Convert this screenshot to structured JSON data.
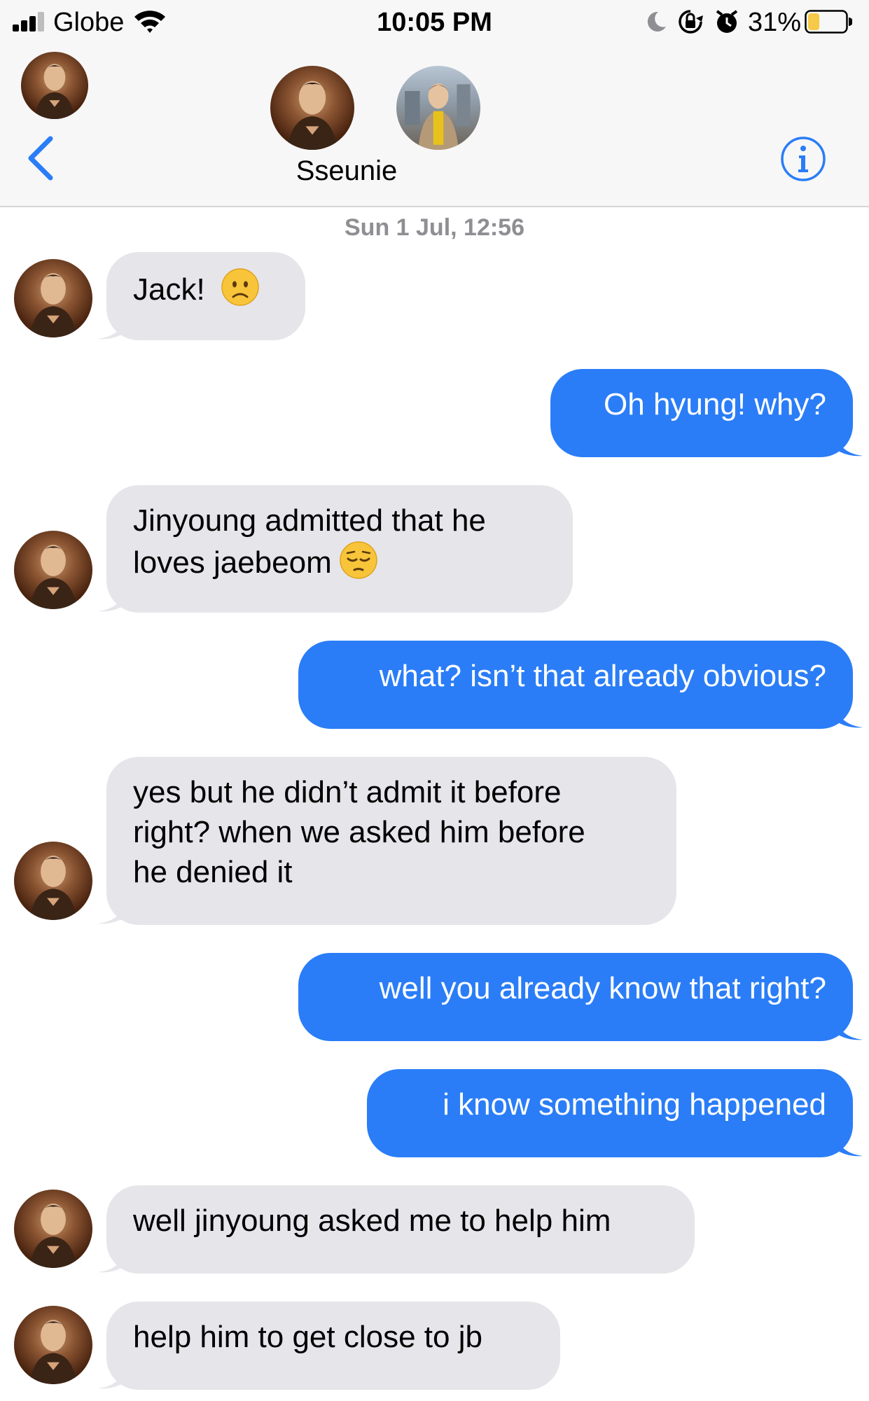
{
  "status_bar": {
    "carrier": "Globe",
    "time": "10:05 PM",
    "battery": "31%",
    "battery_level": 0.31
  },
  "header": {
    "contact_name": "Sseunie",
    "back_icon": "chevron-left-icon",
    "info_icon": "info-icon"
  },
  "conversation": {
    "timestamp": "Sun 1 Jul, 12:56",
    "messages": [
      {
        "from": "them",
        "text": "Jack!",
        "emoji": "slightly-frowning-face"
      },
      {
        "from": "me",
        "text": "Oh hyung! why?"
      },
      {
        "from": "them",
        "line1": "Jinyoung admitted that he",
        "line2": "loves jaebeom",
        "emoji": "pensive-face"
      },
      {
        "from": "me",
        "text": "what? isn’t that already obvious?"
      },
      {
        "from": "them",
        "line1": "yes but he didn’t admit it before",
        "line2": "right? when we asked him before",
        "line3": "he denied it"
      },
      {
        "from": "me",
        "text": "well you already know that right?"
      },
      {
        "from": "me",
        "text": "i know something happened"
      },
      {
        "from": "them",
        "text": "well jinyoung asked me to help him"
      },
      {
        "from": "them",
        "text": "help him to get close to jb"
      }
    ]
  },
  "colors": {
    "outgoing_bubble": "#2a7df7",
    "incoming_bubble": "#e5e5ea",
    "accent": "#2a7df7",
    "battery_fill": "#f7c948"
  }
}
